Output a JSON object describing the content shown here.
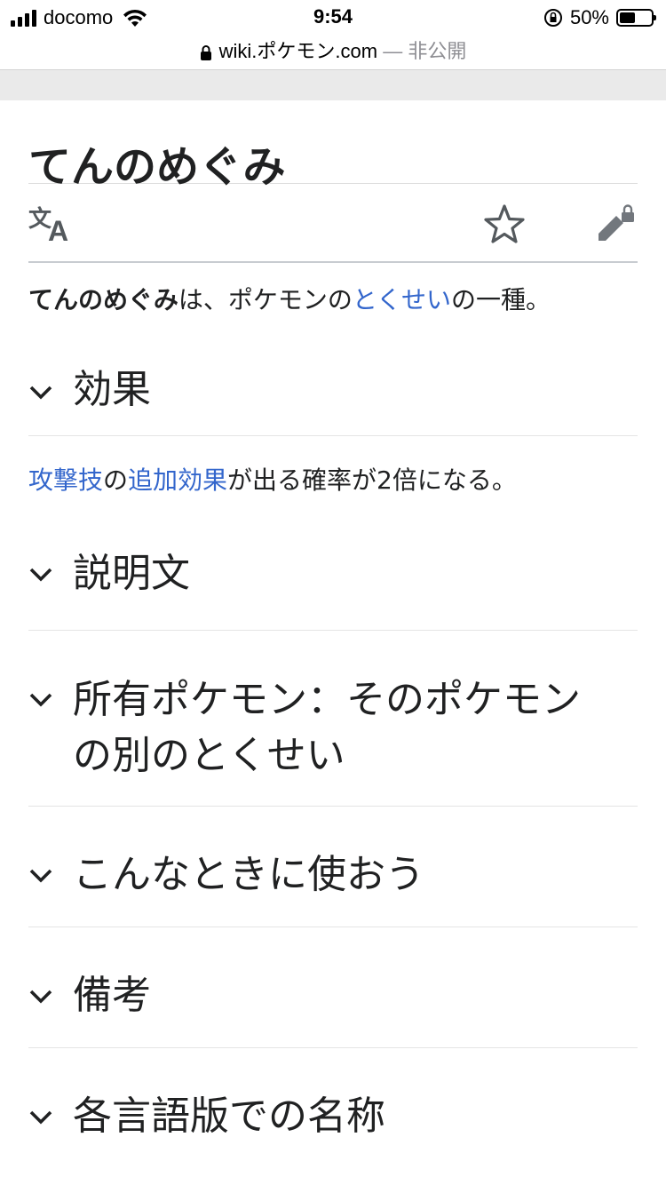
{
  "status": {
    "carrier": "docomo",
    "time": "9:54",
    "battery_percent": "50%",
    "battery_level": 0.5
  },
  "browser": {
    "url": "wiki.ポケモン.com",
    "private_label": "— 非公開"
  },
  "page": {
    "title": "てんのめぐみ",
    "intro": {
      "bold": "てんのめぐみ",
      "t1": "は、ポケモンの",
      "link": "とくせい",
      "t2": "の一種。"
    },
    "sections": [
      {
        "label": "効果"
      },
      {
        "label": "説明文"
      },
      {
        "label_line1": "所有ポケモン：そのポケモン",
        "label_line2": "の別のとくせい"
      },
      {
        "label": "こんなときに使おう"
      },
      {
        "label": "備考"
      },
      {
        "label": "各言語版での名称"
      }
    ],
    "effect": {
      "link1": "攻撃技",
      "t1": "の",
      "link2": "追加効果",
      "t2": "が出る確率が2倍になる。"
    }
  },
  "icons": {
    "language": "translate-icon",
    "watch": "star-icon",
    "edit": "edit-locked-icon"
  },
  "colors": {
    "link": "#3366cc",
    "text": "#202122"
  }
}
